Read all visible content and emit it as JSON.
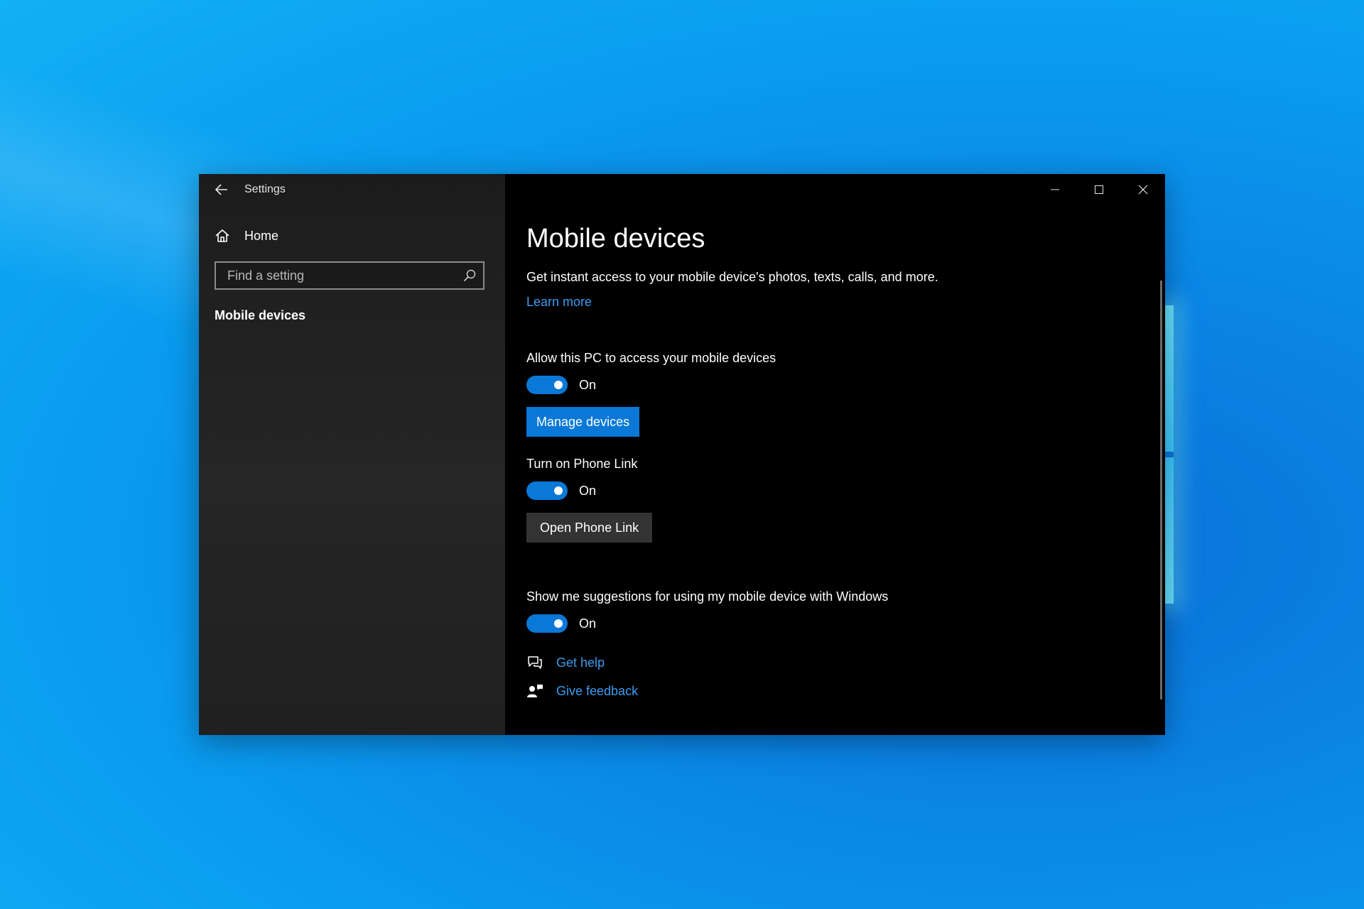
{
  "window": {
    "title": "Settings"
  },
  "sidebar": {
    "home_label": "Home",
    "search_placeholder": "Find a setting",
    "items": [
      {
        "label": "Mobile devices",
        "selected": true
      }
    ]
  },
  "main": {
    "title": "Mobile devices",
    "description": "Get instant access to your mobile device's photos, texts, calls, and more.",
    "learn_more": "Learn more",
    "settings": {
      "allow_access": {
        "label": "Allow this PC to access your mobile devices",
        "state": "On",
        "button": "Manage devices"
      },
      "phone_link": {
        "label": "Turn on Phone Link",
        "state": "On",
        "button": "Open Phone Link"
      },
      "suggestions": {
        "label": "Show me suggestions for using my mobile device with Windows",
        "state": "On"
      }
    },
    "help": {
      "get_help": "Get help",
      "give_feedback": "Give feedback"
    }
  },
  "icons": {
    "back": "back-arrow-icon",
    "home": "home-icon",
    "search": "search-icon",
    "minimize": "minimize-icon",
    "maximize": "maximize-icon",
    "close": "close-icon",
    "help": "help-chat-icon",
    "feedback": "feedback-icon"
  },
  "colors": {
    "accent": "#0a78d7",
    "link": "#3c9bf0",
    "pane_background": "#000000",
    "sidebar_background": "#202020"
  }
}
